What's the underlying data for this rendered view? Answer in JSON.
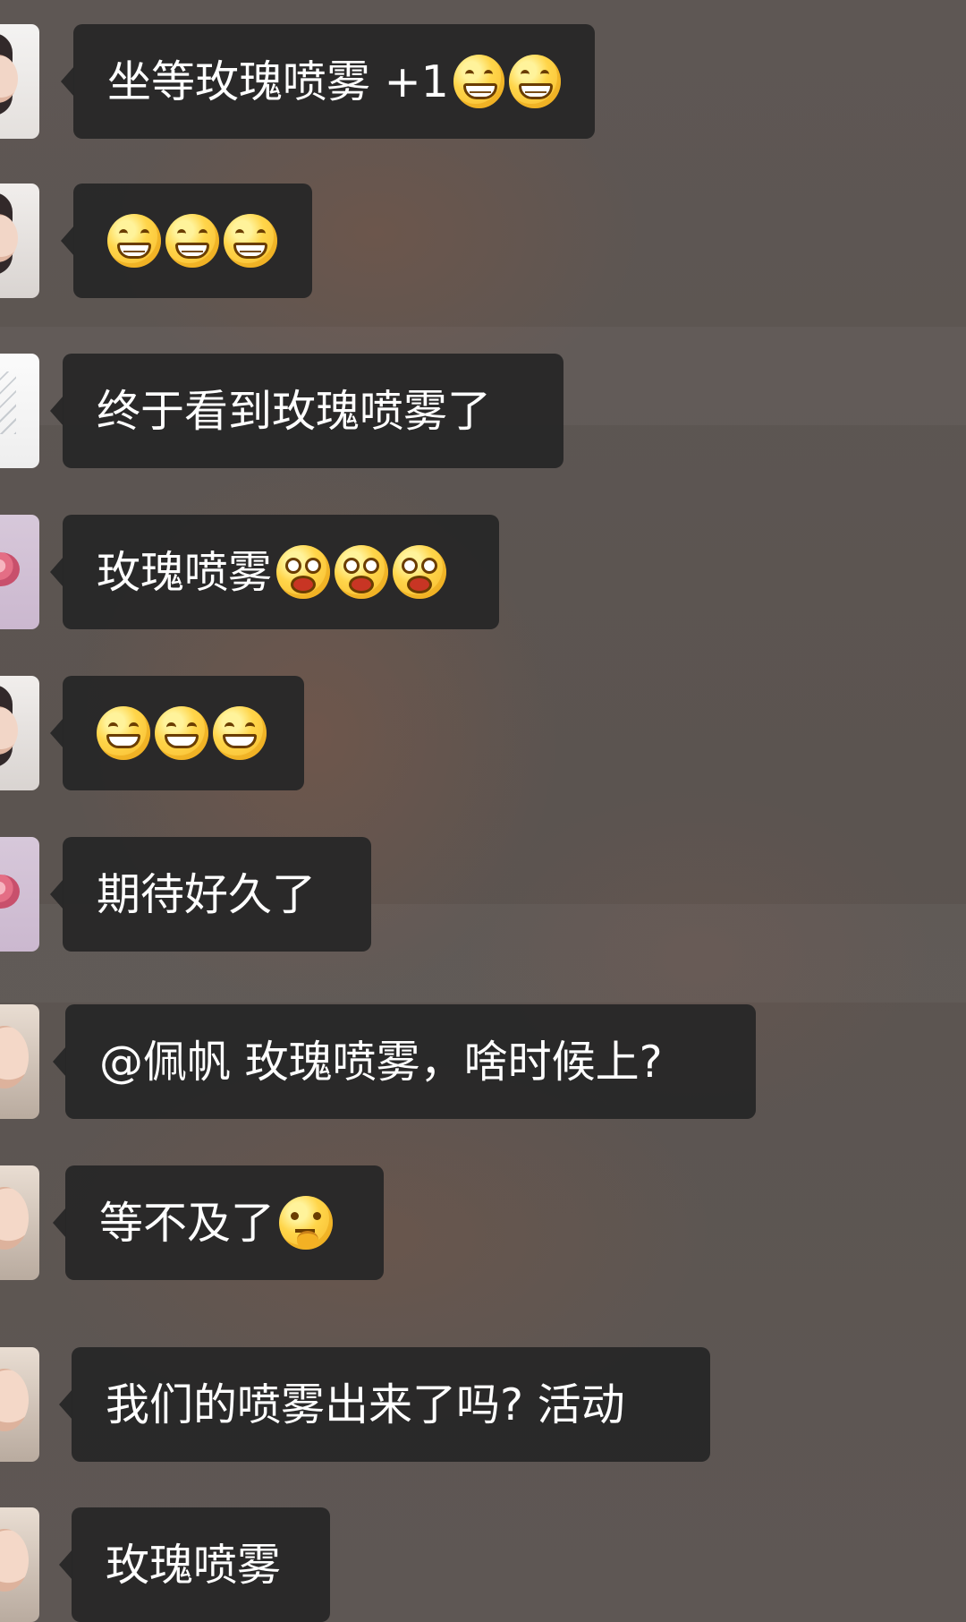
{
  "chat": {
    "messages": [
      {
        "sender_avatar": "woman avatar",
        "text": "坐等玫瑰喷雾 +1",
        "emojis": [
          "grinning-face-icon",
          "grinning-face-icon"
        ]
      },
      {
        "sender_avatar": "woman avatar",
        "text": "",
        "emojis": [
          "grinning-face-icon",
          "grinning-face-icon",
          "grinning-face-icon"
        ]
      },
      {
        "sender_avatar": "illustration avatar",
        "text": "终于看到玫瑰喷雾了",
        "emojis": []
      },
      {
        "sender_avatar": "rose avatar",
        "text": "玫瑰喷雾",
        "emojis": [
          "star-struck-face-icon",
          "star-struck-face-icon",
          "star-struck-face-icon"
        ]
      },
      {
        "sender_avatar": "woman avatar",
        "text": "",
        "emojis": [
          "smiling-face-icon",
          "smiling-face-icon",
          "smiling-face-icon"
        ]
      },
      {
        "sender_avatar": "rose avatar",
        "text": "期待好久了",
        "emojis": []
      },
      {
        "sender_avatar": "child avatar",
        "text": "@佩帆 玫瑰喷雾，啥时候上?",
        "emojis": []
      },
      {
        "sender_avatar": "child avatar",
        "text": "等不及了",
        "emojis": [
          "thinking-face-icon"
        ]
      },
      {
        "sender_avatar": "child avatar",
        "text": "我们的喷雾出来了吗? 活动",
        "emojis": []
      },
      {
        "sender_avatar": "child avatar",
        "text": "玫瑰喷雾",
        "emojis": []
      }
    ]
  }
}
